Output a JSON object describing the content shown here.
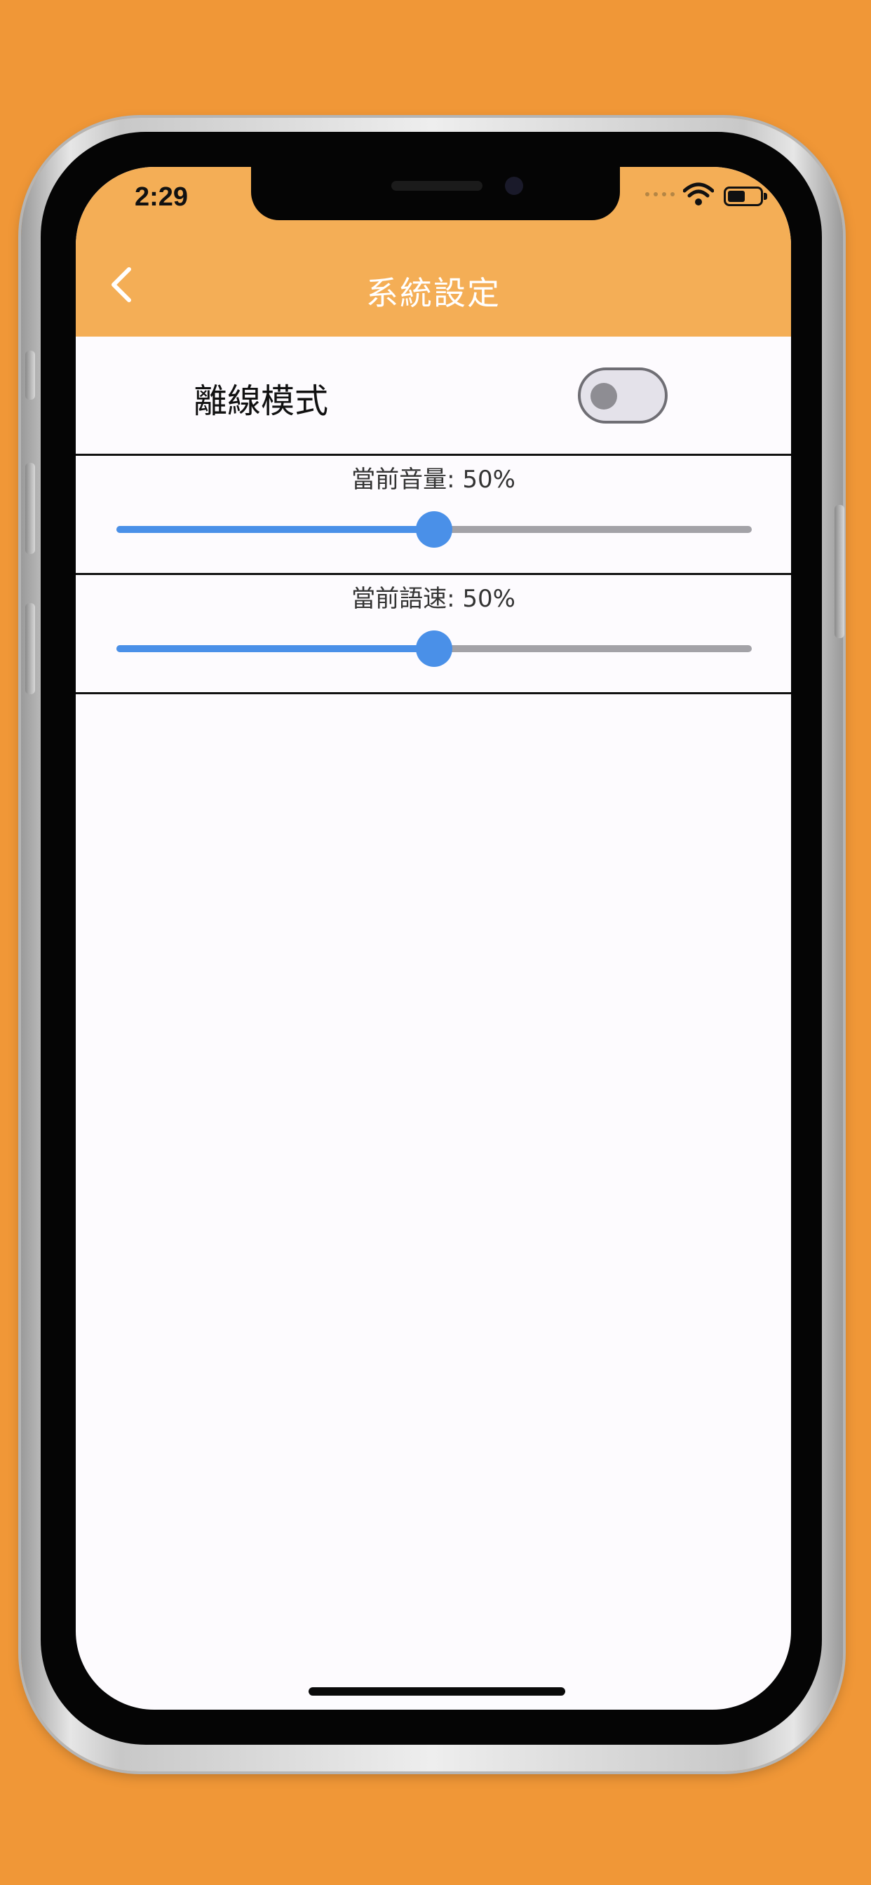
{
  "status_bar": {
    "time": "2:29"
  },
  "header": {
    "title": "系統設定",
    "back_icon": "chevron-left-icon"
  },
  "settings": {
    "offline_mode": {
      "label": "離線模式",
      "enabled": false
    },
    "volume": {
      "label": "當前音量: 50%",
      "value": 0.5
    },
    "speech_rate": {
      "label": "當前語速: 50%",
      "value": 0.5
    }
  },
  "colors": {
    "background": "#F09737",
    "header": "#F4AE56",
    "slider_active": "#4A90E8",
    "slider_inactive": "#A3A2A7"
  }
}
